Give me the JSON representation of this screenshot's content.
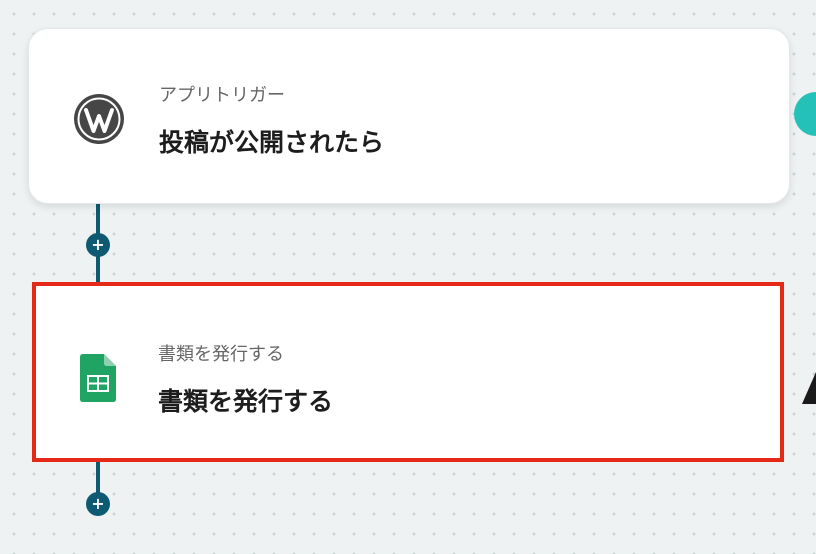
{
  "flow": {
    "trigger": {
      "sublabel": "アプリトリガー",
      "title": "投稿が公開されたら",
      "icon": "wordpress-icon"
    },
    "action": {
      "sublabel": "書類を発行する",
      "title": "書類を発行する",
      "icon": "google-sheets-icon"
    },
    "add_step_label": "+"
  },
  "colors": {
    "connector": "#0e5a72",
    "highlight": "#e42a16",
    "sheets_green": "#1fa463",
    "teal": "#23c1b8"
  }
}
